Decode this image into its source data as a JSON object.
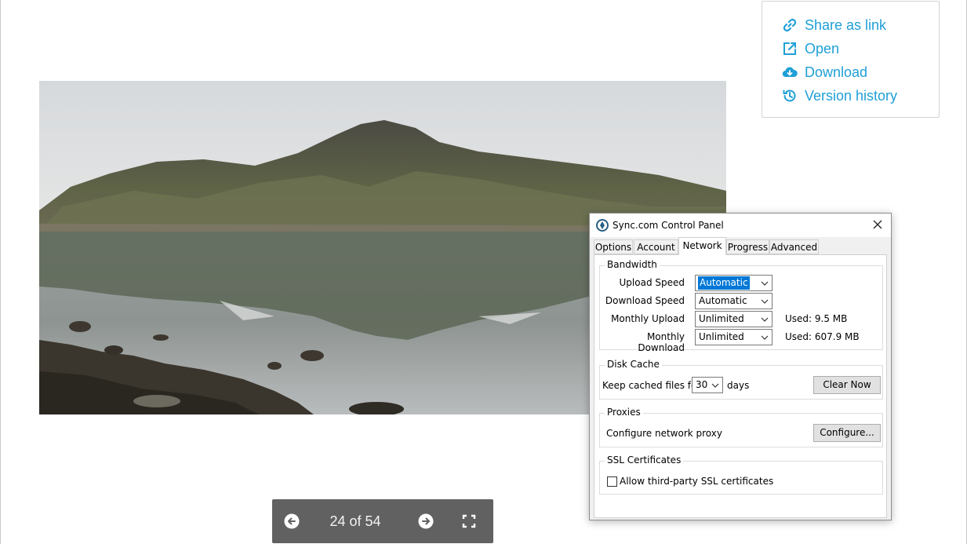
{
  "actions": [
    {
      "label": "Share as link",
      "icon": "link-icon"
    },
    {
      "label": "Open",
      "icon": "external-open-icon"
    },
    {
      "label": "Download",
      "icon": "cloud-download-icon"
    },
    {
      "label": "Version history",
      "icon": "history-icon"
    }
  ],
  "colors": {
    "accent": "#1f9fd6",
    "nav_bg": "#616161",
    "selection": "#0078d7"
  },
  "viewer": {
    "counter": "24 of 54"
  },
  "dialog": {
    "title": "Sync.com Control Panel",
    "tabs": [
      "Options",
      "Account",
      "Network",
      "Progress",
      "Advanced"
    ],
    "active_tab": "Network",
    "bandwidth": {
      "label": "Bandwidth",
      "rows": [
        {
          "label": "Upload Speed",
          "value": "Automatic",
          "used": ""
        },
        {
          "label": "Download Speed",
          "value": "Automatic",
          "used": ""
        },
        {
          "label": "Monthly Upload",
          "value": "Unlimited",
          "used": "Used: 9.5 MB"
        },
        {
          "label": "Monthly Download",
          "value": "Unlimited",
          "used": "Used: 607.9 MB"
        }
      ]
    },
    "disk_cache": {
      "label": "Disk Cache",
      "prefix": "Keep cached files for",
      "value": "30",
      "suffix": "days",
      "button": "Clear Now"
    },
    "proxies": {
      "label": "Proxies",
      "text": "Configure network proxy",
      "button": "Configure..."
    },
    "ssl": {
      "label": "SSL Certificates",
      "checkbox_label": "Allow third-party SSL certificates",
      "checked": false
    }
  }
}
